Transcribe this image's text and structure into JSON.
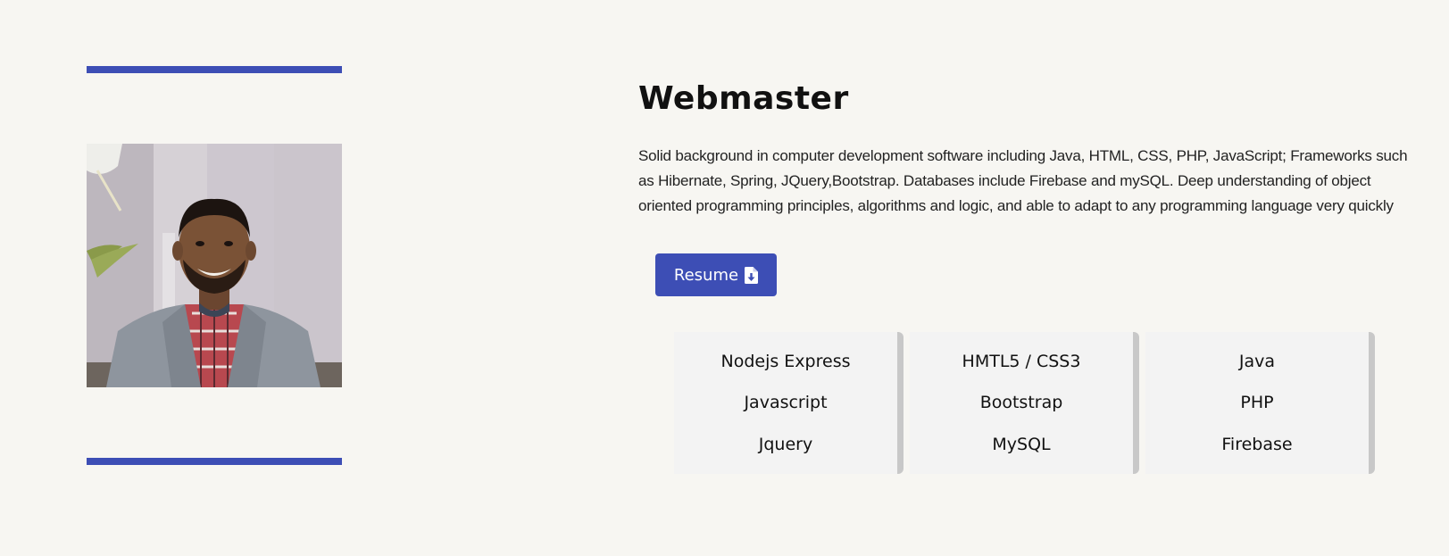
{
  "profile": {
    "title": "Webmaster",
    "bio": "Solid background in computer development software including Java, HTML, CSS, PHP, JavaScript; Frameworks such as Hibernate, Spring, JQuery,Bootstrap. Databases include Firebase and mySQL. Deep understanding of object oriented programming principles, algorithms and logic, and able to adapt to any programming language very quickly",
    "resume_label": "Resume",
    "resume_icon": "file-download-icon"
  },
  "skills": [
    [
      "Nodejs Express",
      "Javascript",
      "Jquery"
    ],
    [
      "HMTL5 / CSS3",
      "Bootstrap",
      "MySQL"
    ],
    [
      "Java",
      "PHP",
      "Firebase"
    ]
  ],
  "colors": {
    "accent": "#3d4eb5",
    "background": "#f7f6f2",
    "card": "#f3f3f3",
    "card_border": "#c8c8c8"
  }
}
